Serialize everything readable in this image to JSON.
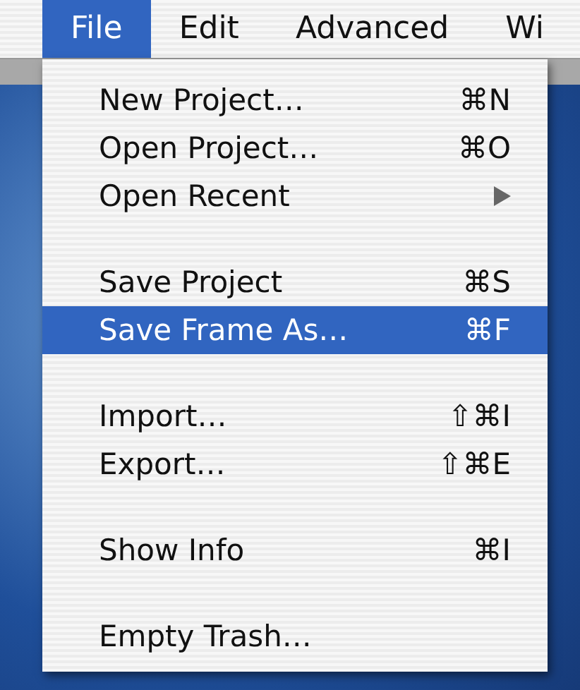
{
  "menu_bar": [
    {
      "label": "File",
      "selected": true
    },
    {
      "label": "Edit",
      "selected": false
    },
    {
      "label": "Advanced",
      "selected": false
    },
    {
      "label": "Wi",
      "selected": false
    }
  ],
  "menu": {
    "items": [
      {
        "kind": "item",
        "label": "New Project…",
        "shortcut": "⌘N",
        "selected": false
      },
      {
        "kind": "item",
        "label": "Open Project…",
        "shortcut": "⌘O",
        "selected": false
      },
      {
        "kind": "submenu",
        "label": "Open Recent",
        "selected": false
      },
      {
        "kind": "separator"
      },
      {
        "kind": "item",
        "label": "Save Project",
        "shortcut": "⌘S",
        "selected": false
      },
      {
        "kind": "item",
        "label": "Save Frame As…",
        "shortcut": "⌘F",
        "selected": true
      },
      {
        "kind": "separator"
      },
      {
        "kind": "item",
        "label": "Import…",
        "shortcut": "⇧⌘I",
        "selected": false
      },
      {
        "kind": "item",
        "label": "Export…",
        "shortcut": "⇧⌘E",
        "selected": false
      },
      {
        "kind": "separator"
      },
      {
        "kind": "item",
        "label": "Show Info",
        "shortcut": "⌘I",
        "selected": false
      },
      {
        "kind": "separator"
      },
      {
        "kind": "item",
        "label": "Empty Trash…",
        "selected": false
      }
    ]
  }
}
